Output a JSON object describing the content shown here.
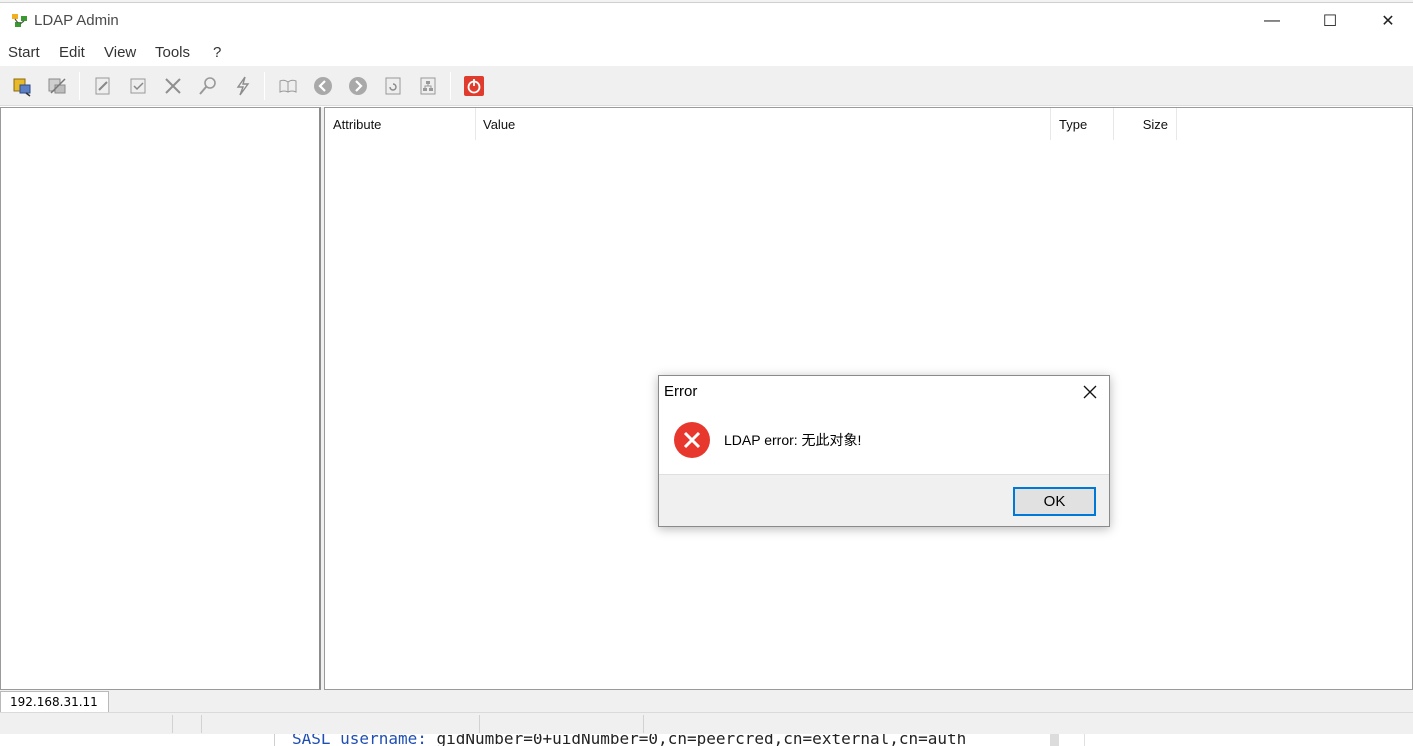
{
  "window": {
    "title": "LDAP Admin",
    "min_glyph": "—",
    "max_glyph": "☐",
    "close_glyph": "✕"
  },
  "menu": {
    "items": [
      "Start",
      "Edit",
      "View",
      "Tools",
      "?"
    ]
  },
  "toolbar": {
    "buttons": [
      "connect-icon",
      "disconnect-icon",
      "edit-entry-icon",
      "save-entry-icon",
      "delete-icon",
      "search-icon",
      "ldap-query-icon",
      "book-icon",
      "back-icon",
      "forward-icon",
      "refresh-icon",
      "schema-icon",
      "exit-icon"
    ]
  },
  "attributes": {
    "columns": [
      "Attribute",
      "Value",
      "Type",
      "Size"
    ]
  },
  "tabs": [
    "192.168.31.11"
  ],
  "background_terminal": {
    "key": "SASL username:",
    "value": "gidNumber=0+uidNumber=0,cn=peercred,cn=external,cn=auth"
  },
  "dialog": {
    "title": "Error",
    "close_glyph": "✕",
    "message": "LDAP error: 无此对象!",
    "ok_label": "OK"
  },
  "colors": {
    "error_red": "#e8382d",
    "focus_blue": "#0078d7",
    "exit_red": "#e03c2e"
  }
}
